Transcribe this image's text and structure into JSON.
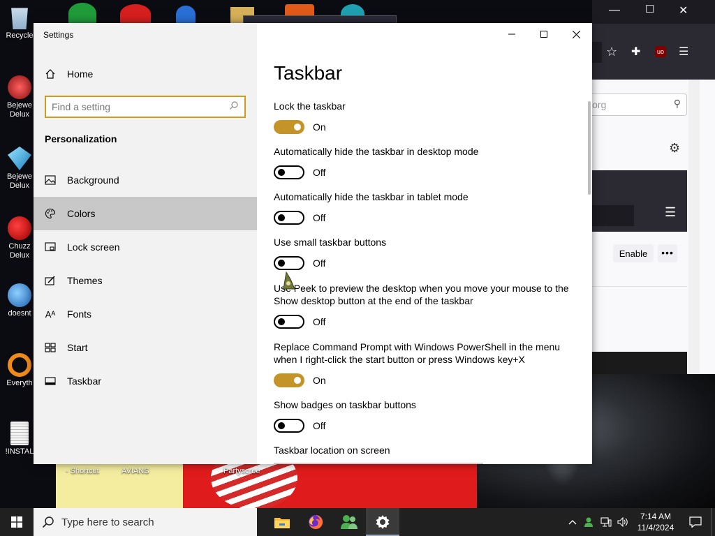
{
  "desktop": {
    "icons": [
      {
        "label": "Recycle",
        "icon": "recycle-bin-icon",
        "color": "#8fb8d8"
      },
      {
        "label": "Bejewe Delux",
        "icon": "bejeweled2-icon",
        "color": "#d83a3a"
      },
      {
        "label": "Bejewe Delux",
        "icon": "bejeweled-icon",
        "color": "#34b6e8"
      },
      {
        "label": "Chuzz Delux",
        "icon": "chuzzle-icon",
        "color": "#e02020"
      },
      {
        "label": "doesnt",
        "icon": "app-icon",
        "color": "#3b8fe0"
      },
      {
        "label": "Everyth",
        "icon": "everything-search-icon",
        "color": "#f08a1a"
      },
      {
        "label": "!INSTAL",
        "icon": "text-file-icon",
        "color": "#e8e8e8"
      }
    ],
    "bottom_labels": [
      "- Shortcut",
      "AVIANS",
      "Partyscree"
    ]
  },
  "firefox": {
    "search_partial": "org",
    "enable_label": "Enable",
    "more_label": "•••"
  },
  "settings": {
    "app_title": "Settings",
    "home_label": "Home",
    "search_placeholder": "Find a setting",
    "section": "Personalization",
    "nav": [
      {
        "label": "Background",
        "icon": "image-icon"
      },
      {
        "label": "Colors",
        "icon": "palette-icon"
      },
      {
        "label": "Lock screen",
        "icon": "lock-screen-icon"
      },
      {
        "label": "Themes",
        "icon": "themes-icon"
      },
      {
        "label": "Fonts",
        "icon": "fonts-icon"
      },
      {
        "label": "Start",
        "icon": "start-icon"
      },
      {
        "label": "Taskbar",
        "icon": "taskbar-icon"
      }
    ],
    "page_title": "Taskbar",
    "settings": [
      {
        "label": "Lock the taskbar",
        "state": "On"
      },
      {
        "label": "Automatically hide the taskbar in desktop mode",
        "state": "Off"
      },
      {
        "label": "Automatically hide the taskbar in tablet mode",
        "state": "Off"
      },
      {
        "label": "Use small taskbar buttons",
        "state": "Off"
      },
      {
        "label": "Use Peek to preview the desktop when you move your mouse to the Show desktop button at the end of the taskbar",
        "state": "Off"
      },
      {
        "label": "Replace Command Prompt with Windows PowerShell in the menu when I right-click the start button or press Windows key+X",
        "state": "On"
      },
      {
        "label": "Show badges on taskbar buttons",
        "state": "Off"
      }
    ],
    "next_heading": "Taskbar location on screen",
    "accent_color": "#c49428"
  },
  "taskbar": {
    "search_placeholder": "Type here to search",
    "time": "7:14 AM",
    "date": "11/4/2024",
    "apps": [
      {
        "name": "file-explorer-icon"
      },
      {
        "name": "firefox-icon"
      },
      {
        "name": "people-app-icon"
      },
      {
        "name": "settings-gear-icon"
      }
    ]
  }
}
